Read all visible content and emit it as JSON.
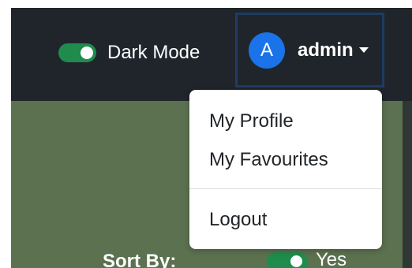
{
  "navbar": {
    "dark_mode": {
      "label": "Dark Mode",
      "enabled": true
    },
    "user": {
      "avatar_initial": "A",
      "name": "admin"
    }
  },
  "user_menu": {
    "items": [
      {
        "label": "My Profile"
      },
      {
        "label": "My Favourites"
      },
      {
        "label": "Logout"
      }
    ]
  },
  "content": {
    "sort_by": {
      "label": "Sort By:",
      "toggle_enabled": true,
      "value": "Yes"
    }
  },
  "colors": {
    "navbar_bg": "#1f252b",
    "content_bg": "#5c7350",
    "toggle_on": "#1f8b4c",
    "avatar_bg": "#1a73e8",
    "user_button_border": "#1f3c61"
  },
  "icons": {
    "user_menu_caret": "caret-down-icon"
  }
}
